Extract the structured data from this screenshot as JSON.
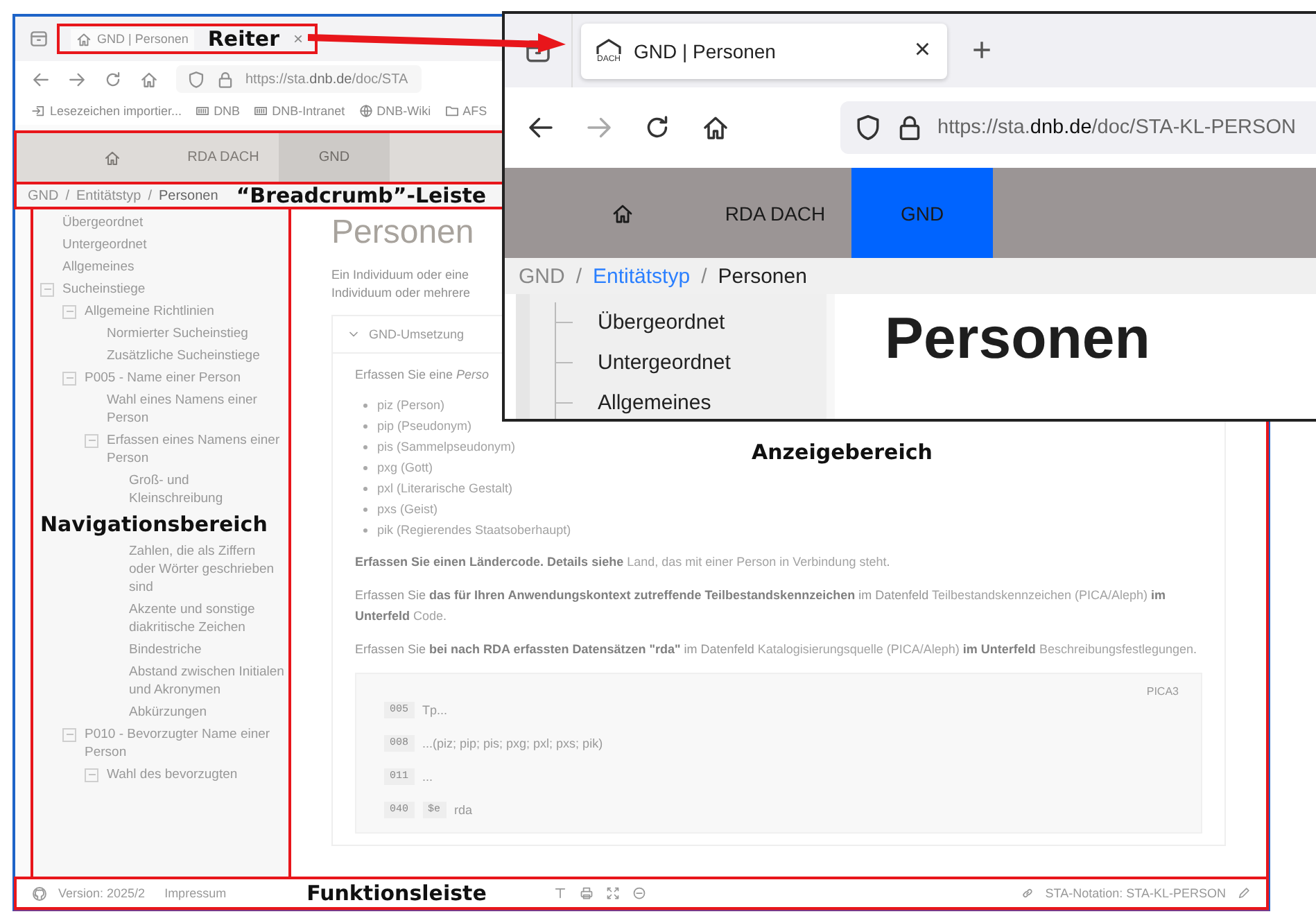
{
  "annotations": {
    "tab_label": "Reiter",
    "breadcrumb_label": "“Breadcrumb”-Leiste",
    "navigation_label": "Navigationsbereich",
    "display_label": "Anzeigebereich",
    "function_label": "Funktionsleiste"
  },
  "screenshot": {
    "tab": {
      "title": "GND | Personen",
      "close": "×"
    },
    "url": {
      "prefix": "https://sta.",
      "domain": "dnb.de",
      "path": "/doc/STA"
    },
    "bookmarks": [
      {
        "label": "Lesezeichen importier...",
        "kind": "import"
      },
      {
        "label": "DNB",
        "kind": "site"
      },
      {
        "label": "DNB-Intranet",
        "kind": "site"
      },
      {
        "label": "DNB-Wiki",
        "kind": "globe"
      },
      {
        "label": "AFS",
        "kind": "folder"
      }
    ],
    "site_nav": [
      {
        "kind": "home",
        "selected": false
      },
      {
        "kind": "text",
        "label": "RDA DACH",
        "selected": false
      },
      {
        "kind": "text",
        "label": "GND",
        "selected": true
      }
    ],
    "breadcrumb": [
      "GND",
      "Entitätstyp",
      "Personen"
    ],
    "breadcrumb_separator": "/",
    "sidebar": [
      {
        "label": "Übergeordnet"
      },
      {
        "label": "Untergeordnet"
      },
      {
        "label": "Allgemeines"
      },
      {
        "label": "Sucheinstiege",
        "expanded": true,
        "children": [
          {
            "label": "Allgemeine Richtlinien",
            "expanded": true,
            "children": [
              {
                "label": "Normierter Sucheinstieg"
              },
              {
                "label": "Zusätzliche Sucheinstiege"
              }
            ]
          },
          {
            "label": "P005 - Name einer Person",
            "expanded": true,
            "children": [
              {
                "label": "Wahl eines Namens einer Person"
              },
              {
                "label": "Erfassen eines Namens einer Person",
                "expanded": true,
                "children": [
                  {
                    "label": "Groß- und Kleinschreibung"
                  },
                  {
                    "label": "Zahlen, die als Ziffern oder Wörter geschrieben sind"
                  },
                  {
                    "label": "Akzente und sonstige diakritische Zeichen"
                  },
                  {
                    "label": "Bindestriche"
                  },
                  {
                    "label": "Abstand zwischen Initialen und Akronymen"
                  },
                  {
                    "label": "Abkürzungen"
                  }
                ]
              }
            ]
          },
          {
            "label": "P010 - Bevorzugter Name einer Person",
            "expanded": true,
            "children": [
              {
                "label": "Wahl des bevorzugten",
                "expanded": true
              }
            ]
          }
        ]
      }
    ],
    "content": {
      "heading": "Personen",
      "intro": [
        "Ein Individuum oder eine",
        "Individuum oder mehrere"
      ],
      "accordion": {
        "title": "GND-Umsetzung",
        "expanded": true,
        "lead": "Erfassen Sie eine *Perso*",
        "codes": [
          "piz (Person)",
          "pip (Pseudonym)",
          "pis (Sammelpseudonym)",
          "pxg (Gott)",
          "pxl (Literarische Gestalt)",
          "pxs (Geist)",
          "pik (Regierendes Staatsoberhaupt)"
        ],
        "paragraphs": [
          [
            {
              "kind": "bold",
              "text": "Erfassen Sie einen Ländercode. Details siehe "
            },
            {
              "kind": "link",
              "text": "Land, das mit einer Person in Verbindung steht"
            },
            {
              "kind": "plain",
              "text": "."
            }
          ],
          [
            {
              "kind": "plain",
              "text": "Erfassen Sie "
            },
            {
              "kind": "bold",
              "text": "das für Ihren Anwendungskontext zutreffende Teilbestandskennzeichen"
            },
            {
              "kind": "plain",
              "text": " im Datenfeld "
            },
            {
              "kind": "link",
              "text": "Teilbestandskennzeichen (PICA/Aleph)"
            },
            {
              "kind": "bold",
              "text": " im Unterfeld "
            },
            {
              "kind": "link",
              "text": "Code"
            },
            {
              "kind": "plain",
              "text": "."
            }
          ],
          [
            {
              "kind": "plain",
              "text": "Erfassen Sie "
            },
            {
              "kind": "bold",
              "text": "bei nach RDA erfassten Datensätzen \"rda\""
            },
            {
              "kind": "plain",
              "text": " im Datenfeld "
            },
            {
              "kind": "link",
              "text": "Katalogisierungsquelle (PICA/Aleph)"
            },
            {
              "kind": "bold",
              "text": " im Unterfeld "
            },
            {
              "kind": "link",
              "text": "Beschreibungsfestlegungen"
            },
            {
              "kind": "plain",
              "text": "."
            }
          ]
        ],
        "code_block": {
          "format": "PICA3",
          "lines": [
            {
              "tag": "005",
              "value": "Tp..."
            },
            {
              "tag": "008",
              "value": "...(piz; pip; pis; pxg; pxl; pxs; pik)"
            },
            {
              "tag": "011",
              "value": "..."
            },
            {
              "tag": "040",
              "subfield": "$e",
              "value": "rda"
            }
          ]
        }
      }
    },
    "footer": {
      "version": "Version: 2025/2",
      "imprint": "Impressum",
      "notation": "STA-Notation: STA-KL-PERSON"
    }
  },
  "zoom_inset": {
    "tab": {
      "logo_text": "DACH",
      "title": "GND | Personen",
      "close": "×",
      "new_tab": "+"
    },
    "url": {
      "prefix": "https://sta.",
      "domain": "dnb.de",
      "path": "/doc/STA-KL-PERSON"
    },
    "site_nav": [
      {
        "kind": "home",
        "selected": false
      },
      {
        "kind": "text",
        "label": "RDA DACH",
        "selected": false
      },
      {
        "kind": "text",
        "label": "GND",
        "selected": true
      }
    ],
    "breadcrumb": [
      "GND",
      "Entitätstyp",
      "Personen"
    ],
    "breadcrumb_separator": "/",
    "sidebar": [
      "Übergeordnet",
      "Untergeordnet",
      "Allgemeines"
    ],
    "heading": "Personen"
  }
}
